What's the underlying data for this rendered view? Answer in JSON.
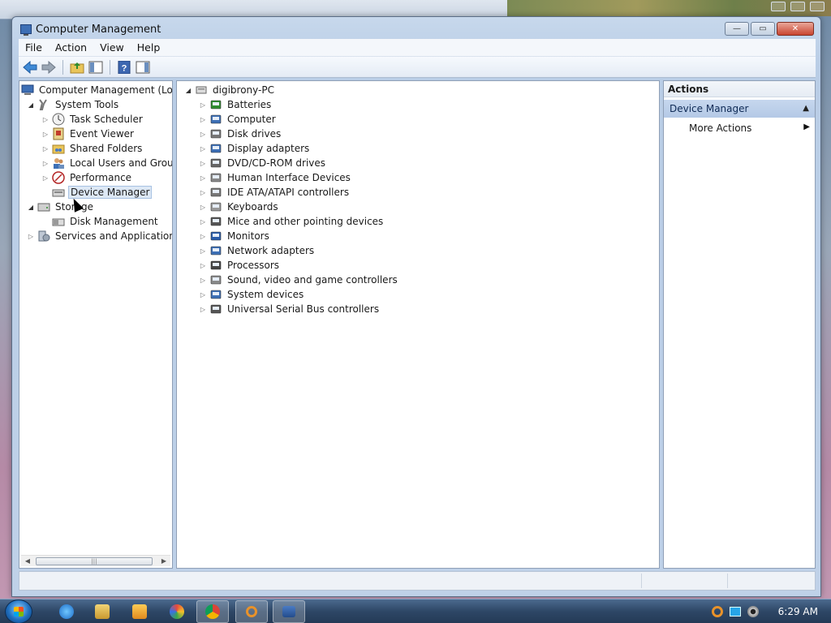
{
  "window": {
    "title": "Computer Management",
    "controls": {
      "minimize": "—",
      "maximize": "▭",
      "close": "✕"
    }
  },
  "menubar": [
    "File",
    "Action",
    "View",
    "Help"
  ],
  "toolbar": {
    "buttons": [
      "back-arrow-icon",
      "forward-arrow-icon",
      "up-folder-icon",
      "show-hide-console-tree-icon",
      "help-icon",
      "show-hide-action-pane-icon"
    ]
  },
  "left_tree": {
    "root": "Computer Management (Local",
    "system_tools": "System Tools",
    "task_scheduler": "Task Scheduler",
    "event_viewer": "Event Viewer",
    "shared_folders": "Shared Folders",
    "local_users": "Local Users and Groups",
    "performance": "Performance",
    "device_manager": "Device Manager",
    "storage": "Storage",
    "disk_management": "Disk Management",
    "services_apps": "Services and Applications"
  },
  "device_tree": {
    "root": "digibrony-PC",
    "items": [
      "Batteries",
      "Computer",
      "Disk drives",
      "Display adapters",
      "DVD/CD-ROM drives",
      "Human Interface Devices",
      "IDE ATA/ATAPI controllers",
      "Keyboards",
      "Mice and other pointing devices",
      "Monitors",
      "Network adapters",
      "Processors",
      "Sound, video and game controllers",
      "System devices",
      "Universal Serial Bus controllers"
    ]
  },
  "actions": {
    "header": "Actions",
    "group": "Device Manager",
    "more": "More Actions"
  },
  "taskbar": {
    "clock": "6:29 AM",
    "apps": [
      "internet-explorer-icon",
      "windows-explorer-icon",
      "media-player-icon",
      "paint-icon",
      "chrome-icon",
      "search-tool-icon",
      "computer-management-icon"
    ]
  },
  "colors": {
    "selection": "#dde8f5",
    "actions_group_bg": "#b4c9e6",
    "taskbar": "#2e4766"
  }
}
